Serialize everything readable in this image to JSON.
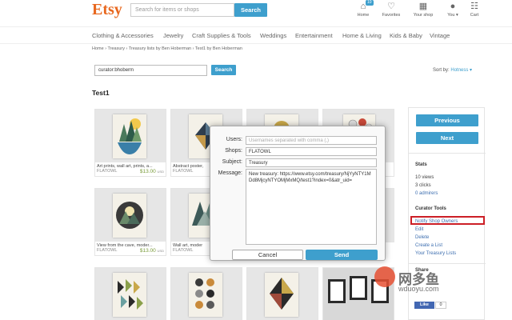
{
  "header": {
    "logo": "Etsy",
    "search_placeholder": "Search for items or shops",
    "search_button": "Search",
    "nav": [
      {
        "label": "Home",
        "icon": "home-icon",
        "badge": "10"
      },
      {
        "label": "Favorites",
        "icon": "heart-icon"
      },
      {
        "label": "Your shop",
        "icon": "shop-icon"
      },
      {
        "label": "You ▾",
        "icon": "user-icon"
      },
      {
        "label": "Cart",
        "icon": "cart-icon"
      }
    ]
  },
  "categories": [
    "Clothing & Accessories",
    "Jewelry",
    "Craft Supplies & Tools",
    "Weddings",
    "Entertainment",
    "Home & Living",
    "Kids & Baby",
    "Vintage"
  ],
  "breadcrumb": "Home › Treasury › Treasury lists by Ben Hoberman › Test1 by Ben Hoberman",
  "curator_search": {
    "value": "curator:bhoberm",
    "button": "Search",
    "sort_label": "Sort by:",
    "sort_value": "Hotness ▾"
  },
  "page_title": "Test1",
  "items": [
    {
      "caption": "Art prints, wall art, prints, a...",
      "shop": "FLATOWL",
      "price": "$13.00",
      "currency": "USD"
    },
    {
      "caption": "Abstract poster,",
      "shop": "FLATOWL",
      "price": "",
      "currency": ""
    },
    {
      "caption": "",
      "shop": "",
      "price": "",
      "currency": ""
    },
    {
      "caption": "",
      "shop": "",
      "price": "",
      "currency": ""
    },
    {
      "caption": "View from the cave, moder...",
      "shop": "FLATOWL",
      "price": "$13.00",
      "currency": "USD"
    },
    {
      "caption": "Wall art, moder",
      "shop": "FLATOWL",
      "price": "",
      "currency": ""
    }
  ],
  "sidebar": {
    "previous": "Previous",
    "next": "Next",
    "stats_heading": "Stats",
    "views": "10 views",
    "clicks": "3 clicks",
    "admirers": "0 admirers",
    "curator_heading": "Curator Tools",
    "notify": "Notify Shop Owners",
    "edit": "Edit",
    "delete": "Delete",
    "create": "Create a List",
    "your_lists": "Your Treasury Lists",
    "share_heading": "Share",
    "like": "Like",
    "like_count": "0"
  },
  "modal": {
    "users_label": "Users:",
    "users_placeholder": "Usernames separated with comma (,)",
    "shops_label": "Shops:",
    "shops_value": "FLATOWL",
    "subject_label": "Subject:",
    "subject_value": "Treasury",
    "message_label": "Message:",
    "message_value": "New treasury: https://www.etsy.com/treasury/NjYyNTY1MDd8MjcyNTYOMjMxMQ/test1?index=0&atr_uid=",
    "cancel": "Cancel",
    "send": "Send"
  },
  "watermark": {
    "cn": "网多鱼",
    "url": "wduoyu.com"
  },
  "colors": {
    "brand": "#e8681f",
    "accent": "#3e9fcd",
    "highlight": "#cc1f26"
  }
}
